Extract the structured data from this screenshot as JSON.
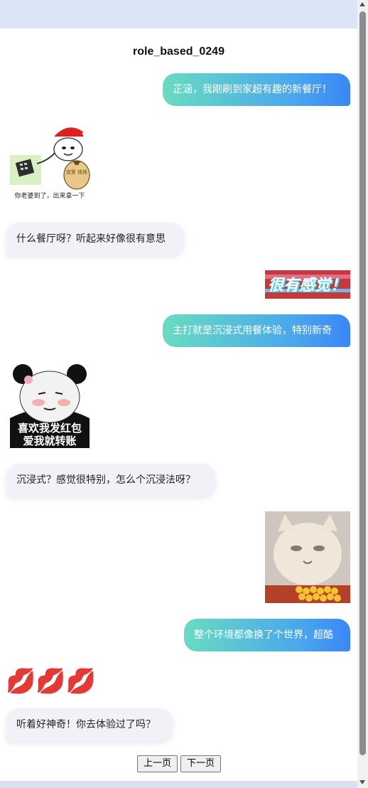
{
  "title": "role_based_0249",
  "messages": [
    {
      "side": "right",
      "text": "芷涵，我刚刷到家超有趣的新餐厅！"
    },
    {
      "side": "left",
      "sticker": "santa-panda-phone-sticker",
      "caption": "你老婆到了，出来拿一下",
      "bag_text": "宠爱 娃娃"
    },
    {
      "side": "left",
      "text": "什么餐厅呀？听起来好像很有意思"
    },
    {
      "side": "right",
      "sticker": "glitch-text-sticker",
      "caption": "很有感觉！"
    },
    {
      "side": "right",
      "text": "主打就是沉浸式用餐体验，特别新奇"
    },
    {
      "side": "left",
      "sticker": "blushing-panda-sticker",
      "caption_line1": "喜欢我发红包",
      "caption_line2": "爱我就转账"
    },
    {
      "side": "left",
      "text": "沉浸式？感觉很特别，怎么个沉浸法呀？"
    },
    {
      "side": "right",
      "sticker": "cat-eating-corn-sticker"
    },
    {
      "side": "right",
      "text": "整个环境都像换了个世界，超酷"
    },
    {
      "side": "left",
      "sticker": "kiss-lips-emoji",
      "emoji": "💋💋💋"
    },
    {
      "side": "left",
      "text": "听着好神奇！你去体验过了吗？"
    }
  ],
  "nav": {
    "prev": "上一页",
    "next": "下一页"
  },
  "colors": {
    "bubble_right_start": "#69dcc0",
    "bubble_right_end": "#3b86f6",
    "bubble_left": "#f0f2f7"
  }
}
